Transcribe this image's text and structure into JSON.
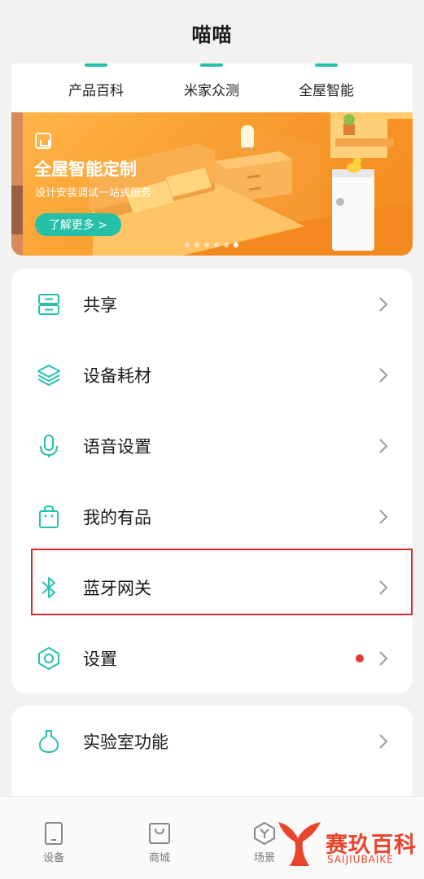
{
  "header": {
    "title": "喵喵"
  },
  "top_tabs": [
    {
      "label": "产品百科",
      "icon": "encyclopedia-icon"
    },
    {
      "label": "米家众测",
      "icon": "crowdtest-icon"
    },
    {
      "label": "全屋智能",
      "icon": "smart-home-icon"
    }
  ],
  "banner": {
    "title": "全屋智能定制",
    "subtitle": "设计安装调试一站式服务",
    "button": "了解更多 >",
    "dot_count": 6,
    "active_dot": 5
  },
  "menu": {
    "items": [
      {
        "label": "共享",
        "icon": "share-icon"
      },
      {
        "label": "设备耗材",
        "icon": "layers-icon"
      },
      {
        "label": "语音设置",
        "icon": "microphone-icon"
      },
      {
        "label": "我的有品",
        "icon": "shopping-bag-icon"
      },
      {
        "label": "蓝牙网关",
        "icon": "bluetooth-icon",
        "highlighted": true
      },
      {
        "label": "设置",
        "icon": "settings-hexagon-icon",
        "has_red_dot": true
      }
    ]
  },
  "lab": {
    "label": "实验室功能",
    "icon": "flask-icon"
  },
  "bottom_nav": [
    {
      "label": "设备",
      "icon": "device-icon"
    },
    {
      "label": "商城",
      "icon": "store-bag-icon"
    },
    {
      "label": "场景",
      "icon": "scene-hexagon-icon"
    }
  ],
  "watermark": {
    "text": "赛玖百科",
    "sub": "SAIJIUBAIKE"
  },
  "colors": {
    "accent": "#26c0ad",
    "highlight_border": "#d9282f",
    "red_dot": "#e53935",
    "banner_orange": "#f8982a",
    "watermark": "#e8452b"
  }
}
